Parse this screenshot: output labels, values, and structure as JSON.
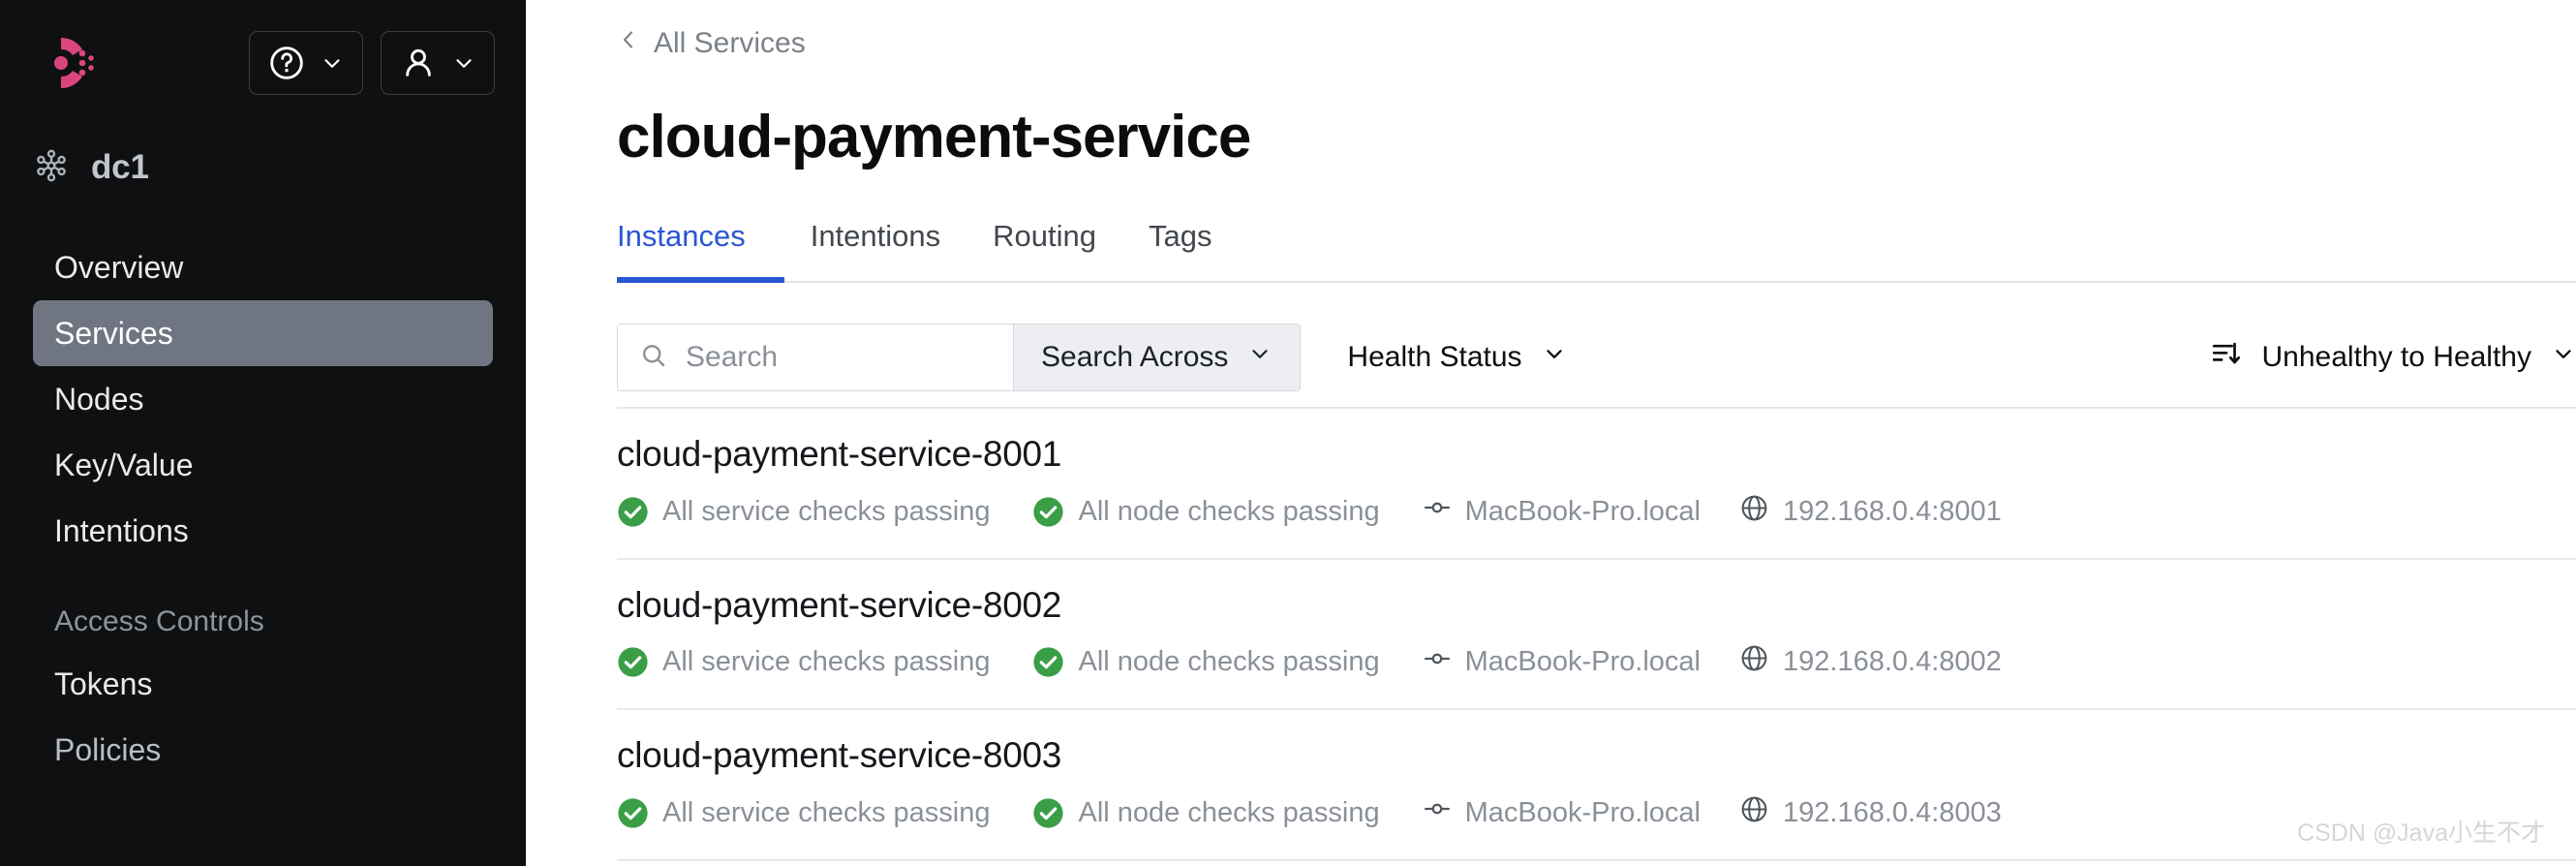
{
  "sidebar": {
    "logo_name": "consul-logo",
    "logo_color": "#d9467c",
    "help_button": {
      "label": "",
      "icon": "question-circle-icon"
    },
    "user_button": {
      "label": "",
      "icon": "user-icon"
    },
    "datacenter": {
      "icon": "datacenter-icon",
      "label": "dc1"
    },
    "nav_items": [
      {
        "label": "Overview",
        "active": false
      },
      {
        "label": "Services",
        "active": true
      },
      {
        "label": "Nodes",
        "active": false
      },
      {
        "label": "Key/Value",
        "active": false
      },
      {
        "label": "Intentions",
        "active": false
      }
    ],
    "section_label": "Access Controls",
    "acl_items": [
      {
        "label": "Tokens"
      },
      {
        "label": "Policies"
      }
    ],
    "active_bg": "#6f7682"
  },
  "main": {
    "breadcrumb": {
      "label": "All Services",
      "icon": "chevron-left-icon"
    },
    "page_title": "cloud-payment-service",
    "tabs": [
      {
        "label": "Instances",
        "active": true
      },
      {
        "label": "Intentions",
        "active": false
      },
      {
        "label": "Routing",
        "active": false
      },
      {
        "label": "Tags",
        "active": false
      }
    ],
    "active_tab_color": "#2a56d4",
    "filters": {
      "search_placeholder": "Search",
      "search_value": "",
      "search_icon": "search-icon",
      "search_across_label": "Search Across",
      "health_status_label": "Health Status",
      "sort_icon": "sort-descending-icon",
      "sort_label": "Unhealthy to Healthy",
      "chevron_icon": "chevron-down-icon"
    },
    "instances": [
      {
        "name": "cloud-payment-service-8001",
        "service_checks": "All service checks passing",
        "node_checks": "All node checks passing",
        "node": "MacBook-Pro.local",
        "address": "192.168.0.4:8001",
        "status_color": "#3a9e47"
      },
      {
        "name": "cloud-payment-service-8002",
        "service_checks": "All service checks passing",
        "node_checks": "All node checks passing",
        "node": "MacBook-Pro.local",
        "address": "192.168.0.4:8002",
        "status_color": "#3a9e47"
      },
      {
        "name": "cloud-payment-service-8003",
        "service_checks": "All service checks passing",
        "node_checks": "All node checks passing",
        "node": "MacBook-Pro.local",
        "address": "192.168.0.4:8003",
        "status_color": "#3a9e47"
      }
    ]
  },
  "watermark": "CSDN @Java小生不才"
}
